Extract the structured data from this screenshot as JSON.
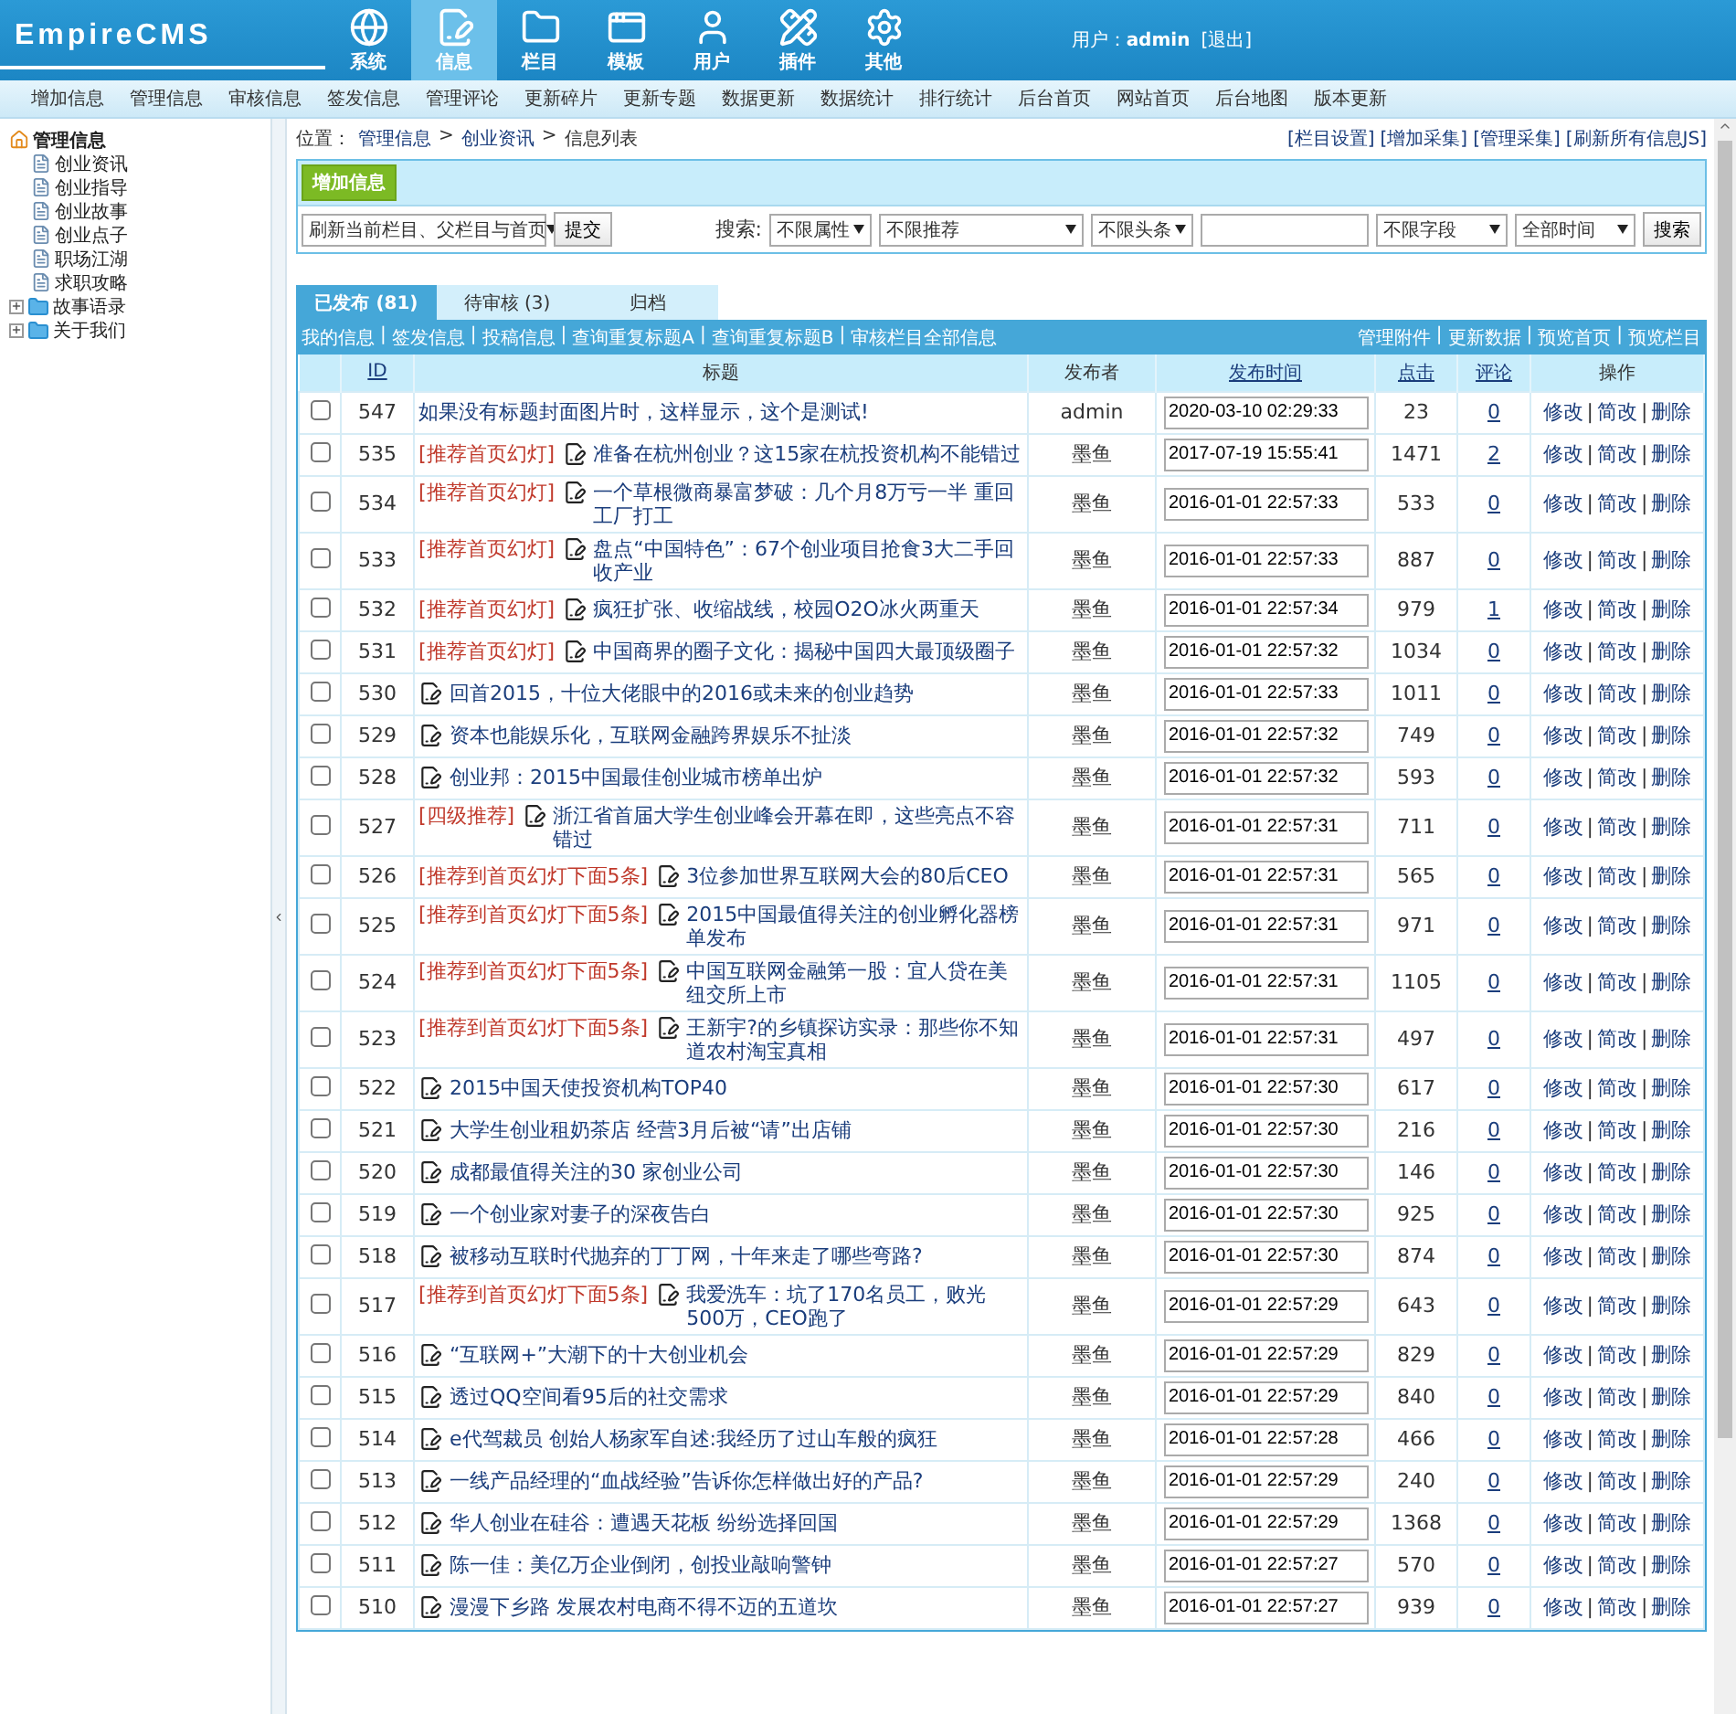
{
  "header": {
    "logo": "EmpireCMS",
    "nav": [
      {
        "label": "系统",
        "kind": "globe",
        "selected": false
      },
      {
        "label": "信息",
        "kind": "edit",
        "selected": true
      },
      {
        "label": "栏目",
        "kind": "folder",
        "selected": false
      },
      {
        "label": "模板",
        "kind": "window",
        "selected": false
      },
      {
        "label": "用户",
        "kind": "user",
        "selected": false
      },
      {
        "label": "插件",
        "kind": "tools",
        "selected": false
      },
      {
        "label": "其他",
        "kind": "gear",
        "selected": false
      }
    ],
    "user_label": "用户：",
    "user": "admin",
    "logout": "[退出]"
  },
  "menu": [
    "增加信息",
    "管理信息",
    "审核信息",
    "签发信息",
    "管理评论",
    "更新碎片",
    "更新专题",
    "数据更新",
    "数据统计",
    "排行统计",
    "后台首页",
    "网站首页",
    "后台地图",
    "版本更新"
  ],
  "sidebar": [
    {
      "label": "管理信息",
      "kind": "root",
      "children": [
        {
          "label": "创业资讯",
          "kind": "page"
        },
        {
          "label": "创业指导",
          "kind": "page"
        },
        {
          "label": "创业故事",
          "kind": "page"
        },
        {
          "label": "创业点子",
          "kind": "page"
        },
        {
          "label": "职场江湖",
          "kind": "page"
        },
        {
          "label": "求职攻略",
          "kind": "page"
        }
      ]
    },
    {
      "label": "故事语录",
      "kind": "folder",
      "expanded": false
    },
    {
      "label": "关于我们",
      "kind": "folder",
      "expanded": false
    }
  ],
  "breadcrumb": {
    "label": "位置：",
    "separator": ">",
    "items": [
      "管理信息",
      "创业资讯",
      "信息列表"
    ]
  },
  "top_links": [
    "[栏目设置]",
    "[增加采集]",
    "[管理采集]",
    "[刷新所有信息JS]"
  ],
  "add_button": "增加信息",
  "refresh_select": "刷新当前栏目、父栏目与首页",
  "submit": "提交",
  "search": {
    "label": "搜索:",
    "selects": [
      "不限属性",
      "不限推荐",
      "不限头条"
    ],
    "field_select": "不限字段",
    "time_select": "全部时间",
    "button": "搜索"
  },
  "tabs": [
    {
      "label": "已发布 (81)",
      "selected": true
    },
    {
      "label": "待审核 (3)",
      "selected": false
    },
    {
      "label": "归档",
      "selected": false
    }
  ],
  "sub_links": [
    "我的信息",
    "|",
    "签发信息",
    "|",
    "投稿信息",
    "|",
    "查询重复标题A",
    "|",
    "查询重复标题B",
    "|",
    "审核栏目全部信息"
  ],
  "right_links": [
    "管理附件",
    "|",
    "更新数据",
    "|",
    "预览首页",
    "|",
    "预览栏目"
  ],
  "action_separator": "|",
  "columns": [
    {
      "label": "ID",
      "link": true
    },
    {
      "label": "标题",
      "link": false
    },
    {
      "label": "发布者",
      "link": false
    },
    {
      "label": "发布时间",
      "link": true
    },
    {
      "label": "点击",
      "link": true
    },
    {
      "label": "评论",
      "link": true
    },
    {
      "label": "操作",
      "link": false
    }
  ],
  "rows": [
    {
      "checked": false,
      "id": "547",
      "kind": "text",
      "title": "如果没有标题封面图片时，这样显示，这个是测试!",
      "publisher": "admin",
      "time": "2020-03-10 02:29:33",
      "clicks": "23",
      "comments": "0",
      "actions": [
        "修改",
        "简改",
        "删除"
      ]
    },
    {
      "checked": false,
      "id": "535",
      "kind": "edited",
      "tag": "[推荐首页幻灯]",
      "title": "准备在杭州创业？这15家在杭投资机构不能错过",
      "publisher": "墨鱼",
      "time": "2017-07-19 15:55:41",
      "clicks": "1471",
      "comments": "2",
      "actions": [
        "修改",
        "简改",
        "删除"
      ]
    },
    {
      "checked": false,
      "id": "534",
      "kind": "edited",
      "tag": "[推荐首页幻灯]",
      "title": "一个草根微商暴富梦破：几个月8万亏一半 重回工厂打工",
      "publisher": "墨鱼",
      "time": "2016-01-01 22:57:33",
      "clicks": "533",
      "comments": "0",
      "actions": [
        "修改",
        "简改",
        "删除"
      ]
    },
    {
      "checked": false,
      "id": "533",
      "kind": "edited",
      "tag": "[推荐首页幻灯]",
      "title": "盘点“中国特色”：67个创业项目抢食3大二手回收产业",
      "publisher": "墨鱼",
      "time": "2016-01-01 22:57:33",
      "clicks": "887",
      "comments": "0",
      "actions": [
        "修改",
        "简改",
        "删除"
      ]
    },
    {
      "checked": false,
      "id": "532",
      "kind": "edited",
      "tag": "[推荐首页幻灯]",
      "title": "疯狂扩张、收缩战线，校园O2O冰火两重天",
      "publisher": "墨鱼",
      "time": "2016-01-01 22:57:34",
      "clicks": "979",
      "comments": "1",
      "actions": [
        "修改",
        "简改",
        "删除"
      ]
    },
    {
      "checked": false,
      "id": "531",
      "kind": "edited",
      "tag": "[推荐首页幻灯]",
      "title": "中国商界的圈子文化：揭秘中国四大最顶级圈子",
      "publisher": "墨鱼",
      "time": "2016-01-01 22:57:32",
      "clicks": "1034",
      "comments": "0",
      "actions": [
        "修改",
        "简改",
        "删除"
      ]
    },
    {
      "checked": false,
      "id": "530",
      "kind": "edited",
      "title": "回首2015，十位大佬眼中的2016或未来的创业趋势",
      "publisher": "墨鱼",
      "time": "2016-01-01 22:57:33",
      "clicks": "1011",
      "comments": "0",
      "actions": [
        "修改",
        "简改",
        "删除"
      ]
    },
    {
      "checked": false,
      "id": "529",
      "kind": "edited",
      "title": "资本也能娱乐化，互联网金融跨界娱乐不扯淡",
      "publisher": "墨鱼",
      "time": "2016-01-01 22:57:32",
      "clicks": "749",
      "comments": "0",
      "actions": [
        "修改",
        "简改",
        "删除"
      ]
    },
    {
      "checked": false,
      "id": "528",
      "kind": "edited",
      "title": "创业邦：2015中国最佳创业城市榜单出炉",
      "publisher": "墨鱼",
      "time": "2016-01-01 22:57:32",
      "clicks": "593",
      "comments": "0",
      "actions": [
        "修改",
        "简改",
        "删除"
      ]
    },
    {
      "checked": false,
      "id": "527",
      "kind": "edited",
      "tag": "[四级推荐]",
      "title": "浙江省首届大学生创业峰会开幕在即，这些亮点不容错过",
      "publisher": "墨鱼",
      "time": "2016-01-01 22:57:31",
      "clicks": "711",
      "comments": "0",
      "actions": [
        "修改",
        "简改",
        "删除"
      ]
    },
    {
      "checked": false,
      "id": "526",
      "kind": "edited",
      "tag": "[推荐到首页幻灯下面5条]",
      "title": "3位参加世界互联网大会的80后CEO",
      "publisher": "墨鱼",
      "time": "2016-01-01 22:57:31",
      "clicks": "565",
      "comments": "0",
      "actions": [
        "修改",
        "简改",
        "删除"
      ]
    },
    {
      "checked": false,
      "id": "525",
      "kind": "edited",
      "tag": "[推荐到首页幻灯下面5条]",
      "title": "2015中国最值得关注的创业孵化器榜单发布",
      "publisher": "墨鱼",
      "time": "2016-01-01 22:57:31",
      "clicks": "971",
      "comments": "0",
      "actions": [
        "修改",
        "简改",
        "删除"
      ]
    },
    {
      "checked": false,
      "id": "524",
      "kind": "edited",
      "tag": "[推荐到首页幻灯下面5条]",
      "title": "中国互联网金融第一股：宜人贷在美纽交所上市",
      "publisher": "墨鱼",
      "time": "2016-01-01 22:57:31",
      "clicks": "1105",
      "comments": "0",
      "actions": [
        "修改",
        "简改",
        "删除"
      ]
    },
    {
      "checked": false,
      "id": "523",
      "kind": "edited",
      "tag": "[推荐到首页幻灯下面5条]",
      "title": "王新宇?的乡镇探访实录：那些你不知道农村淘宝真相",
      "publisher": "墨鱼",
      "time": "2016-01-01 22:57:31",
      "clicks": "497",
      "comments": "0",
      "actions": [
        "修改",
        "简改",
        "删除"
      ]
    },
    {
      "checked": false,
      "id": "522",
      "kind": "edited",
      "title": "2015中国天使投资机构TOP40",
      "publisher": "墨鱼",
      "time": "2016-01-01 22:57:30",
      "clicks": "617",
      "comments": "0",
      "actions": [
        "修改",
        "简改",
        "删除"
      ]
    },
    {
      "checked": false,
      "id": "521",
      "kind": "edited",
      "title": "大学生创业租奶茶店 经营3月后被“请”出店铺",
      "publisher": "墨鱼",
      "time": "2016-01-01 22:57:30",
      "clicks": "216",
      "comments": "0",
      "actions": [
        "修改",
        "简改",
        "删除"
      ]
    },
    {
      "checked": false,
      "id": "520",
      "kind": "edited",
      "title": "成都最值得关注的30 家创业公司",
      "publisher": "墨鱼",
      "time": "2016-01-01 22:57:30",
      "clicks": "146",
      "comments": "0",
      "actions": [
        "修改",
        "简改",
        "删除"
      ]
    },
    {
      "checked": false,
      "id": "519",
      "kind": "edited",
      "title": "一个创业家对妻子的深夜告白",
      "publisher": "墨鱼",
      "time": "2016-01-01 22:57:30",
      "clicks": "925",
      "comments": "0",
      "actions": [
        "修改",
        "简改",
        "删除"
      ]
    },
    {
      "checked": false,
      "id": "518",
      "kind": "edited",
      "title": "被移动互联时代抛弃的丁丁网，十年来走了哪些弯路?",
      "publisher": "墨鱼",
      "time": "2016-01-01 22:57:30",
      "clicks": "874",
      "comments": "0",
      "actions": [
        "修改",
        "简改",
        "删除"
      ]
    },
    {
      "checked": false,
      "id": "517",
      "kind": "edited",
      "tag": "[推荐到首页幻灯下面5条]",
      "title": "我爱洗车：坑了170名员工，败光500万，CEO跑了",
      "publisher": "墨鱼",
      "time": "2016-01-01 22:57:29",
      "clicks": "643",
      "comments": "0",
      "actions": [
        "修改",
        "简改",
        "删除"
      ]
    },
    {
      "checked": false,
      "id": "516",
      "kind": "edited",
      "title": "“互联网+”大潮下的十大创业机会",
      "publisher": "墨鱼",
      "time": "2016-01-01 22:57:29",
      "clicks": "829",
      "comments": "0",
      "actions": [
        "修改",
        "简改",
        "删除"
      ]
    },
    {
      "checked": false,
      "id": "515",
      "kind": "edited",
      "title": "透过QQ空间看95后的社交需求",
      "publisher": "墨鱼",
      "time": "2016-01-01 22:57:29",
      "clicks": "840",
      "comments": "0",
      "actions": [
        "修改",
        "简改",
        "删除"
      ]
    },
    {
      "checked": false,
      "id": "514",
      "kind": "edited",
      "title": "e代驾裁员 创始人杨家军自述:我经历了过山车般的疯狂",
      "publisher": "墨鱼",
      "time": "2016-01-01 22:57:28",
      "clicks": "466",
      "comments": "0",
      "actions": [
        "修改",
        "简改",
        "删除"
      ]
    },
    {
      "checked": false,
      "id": "513",
      "kind": "edited",
      "title": "一线产品经理的“血战经验”告诉你怎样做出好的产品?",
      "publisher": "墨鱼",
      "time": "2016-01-01 22:57:29",
      "clicks": "240",
      "comments": "0",
      "actions": [
        "修改",
        "简改",
        "删除"
      ]
    },
    {
      "checked": false,
      "id": "512",
      "kind": "edited",
      "title": "华人创业在硅谷：遭遇天花板 纷纷选择回国",
      "publisher": "墨鱼",
      "time": "2016-01-01 22:57:29",
      "clicks": "1368",
      "comments": "0",
      "actions": [
        "修改",
        "简改",
        "删除"
      ]
    },
    {
      "checked": false,
      "id": "511",
      "kind": "edited",
      "title": "陈一佳：美亿万企业倒闭，创投业敲响警钟",
      "publisher": "墨鱼",
      "time": "2016-01-01 22:57:27",
      "clicks": "570",
      "comments": "0",
      "actions": [
        "修改",
        "简改",
        "删除"
      ]
    },
    {
      "checked": false,
      "id": "510",
      "kind": "edited",
      "title": "漫漫下乡路 发展农村电商不得不迈的五道坎",
      "publisher": "墨鱼",
      "time": "2016-01-01 22:57:27",
      "clicks": "939",
      "comments": "0",
      "actions": [
        "修改",
        "简改",
        "删除"
      ]
    }
  ]
}
